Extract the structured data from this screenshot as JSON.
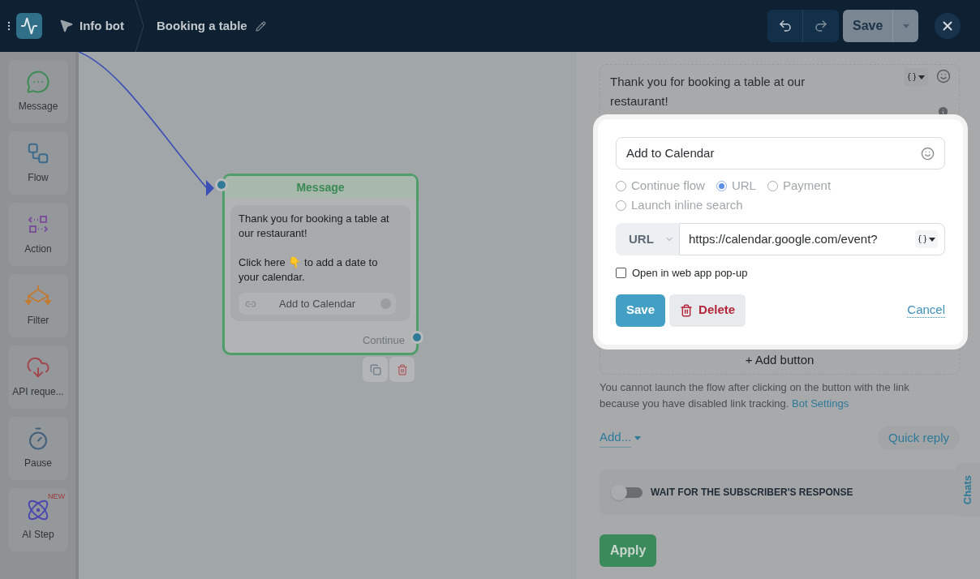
{
  "header": {
    "bot_name": "Info bot",
    "flow_name": "Booking a table",
    "save_label": "Save"
  },
  "sidebar": {
    "items": [
      {
        "label": "Message",
        "kind": "message"
      },
      {
        "label": "Flow",
        "kind": "flow"
      },
      {
        "label": "Action",
        "kind": "action"
      },
      {
        "label": "Filter",
        "kind": "filter"
      },
      {
        "label": "API reque...",
        "kind": "api"
      },
      {
        "label": "Pause",
        "kind": "pause"
      },
      {
        "label": "AI Step",
        "kind": "ai",
        "badge": "NEW"
      }
    ]
  },
  "canvas": {
    "node": {
      "title": "Message",
      "paragraphs": [
        "Thank you for booking a table at our restaurant!",
        "Click here 👇 to add a date to your calendar."
      ],
      "button": "Add to Calendar",
      "output": "Continue"
    }
  },
  "panel": {
    "message_text": "Thank you for booking a table at our restaurant!",
    "add_button": "+ Add button",
    "notice": "You cannot launch the flow after clicking on the button with the link because you have disabled link tracking.",
    "notice_link": "Bot Settings",
    "add_menu": "Add...",
    "quick_reply": "Quick reply",
    "wait_toggle": {
      "label": "WAIT FOR THE SUBSCRIBER'S RESPONSE",
      "on": false
    },
    "apply": "Apply",
    "chats_tab": "Chats"
  },
  "popup": {
    "button_text": "Add to Calendar",
    "actions": [
      {
        "label": "Continue flow",
        "selected": false
      },
      {
        "label": "URL",
        "selected": true
      },
      {
        "label": "Payment",
        "selected": false
      },
      {
        "label": "Launch inline search",
        "selected": false
      }
    ],
    "url_type": "URL",
    "url": "https://calendar.google.com/event?",
    "open_in_webapp": {
      "label": "Open in web app pop-up",
      "checked": false
    },
    "save": "Save",
    "delete": "Delete",
    "cancel": "Cancel"
  }
}
